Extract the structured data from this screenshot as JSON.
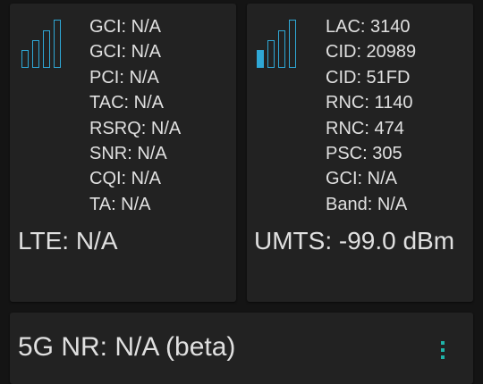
{
  "lte": {
    "signal_bars": {
      "total": 4,
      "filled": 0
    },
    "fields": [
      "GCI: N/A",
      "GCI: N/A",
      "PCI: N/A",
      "TAC: N/A",
      "RSRQ: N/A",
      "SNR: N/A",
      "CQI: N/A",
      "TA: N/A"
    ],
    "summary": "LTE: N/A"
  },
  "umts": {
    "signal_bars": {
      "total": 4,
      "filled": 1
    },
    "fields": [
      "LAC: 3140",
      "CID: 20989",
      "CID: 51FD",
      "RNC: 1140",
      "RNC: 474",
      "PSC: 305",
      "GCI: N/A",
      "Band: N/A"
    ],
    "summary": "UMTS: -99.0 dBm"
  },
  "nr": {
    "summary": "5G NR: N/A (beta)",
    "menu_icon": "more-vert-icon"
  },
  "colors": {
    "accent_bars": "#2fa8d6",
    "menu_icon": "#1fb3a8",
    "card_bg": "#222222",
    "page_bg": "#141414"
  }
}
